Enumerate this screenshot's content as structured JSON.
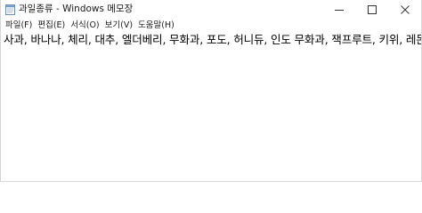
{
  "window": {
    "title": "과일종류 - Windows 메모장"
  },
  "menu": {
    "items": [
      {
        "label": "파일(F)"
      },
      {
        "label": "편집(E)"
      },
      {
        "label": "서식(O)"
      },
      {
        "label": "보기(V)"
      },
      {
        "label": "도움말(H)"
      }
    ]
  },
  "editor": {
    "content": "사과, 바나나, 체리, 대추, 엘더베리, 무화과, 포도, 허니듀, 인도 무화과, 잭프루트, 키위, 레몬"
  },
  "icons": {
    "app": "notepad-icon",
    "minimize": "minimize-icon",
    "maximize": "maximize-icon",
    "close": "close-icon"
  }
}
